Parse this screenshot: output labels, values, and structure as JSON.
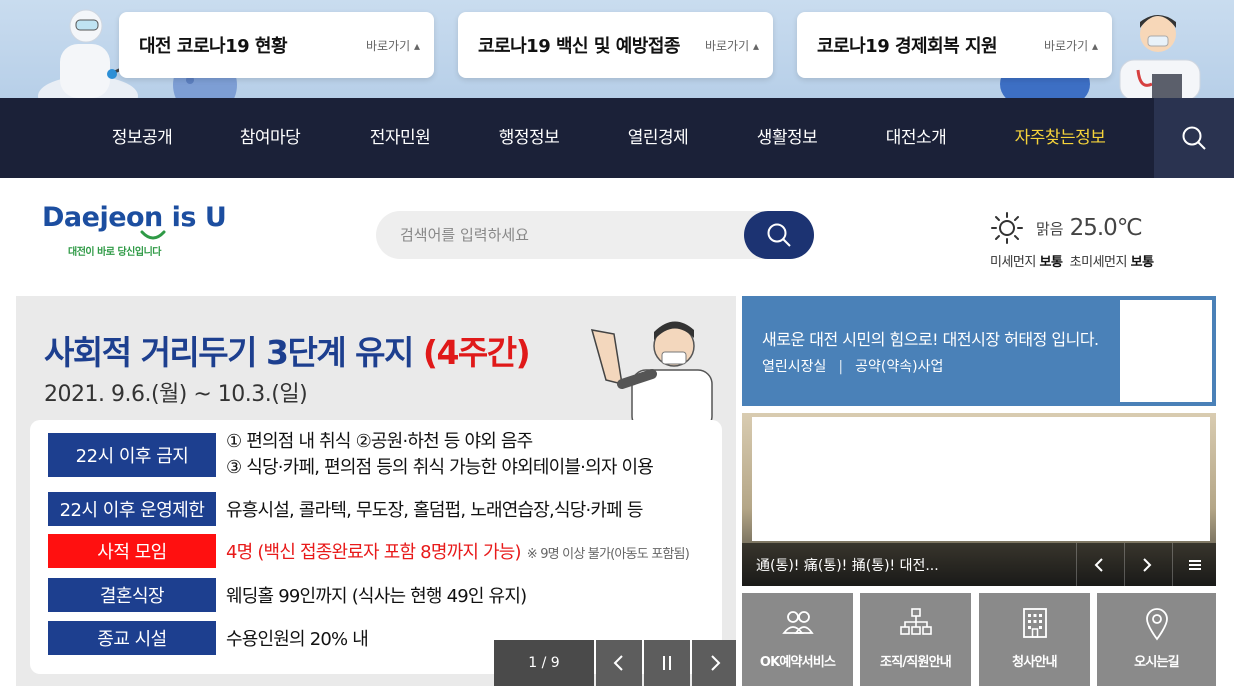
{
  "quick_links": [
    {
      "title": "대전 코로나19 현황",
      "link": "바로가기"
    },
    {
      "title": "코로나19 백신 및 예방접종",
      "link": "바로가기"
    },
    {
      "title": "코로나19 경제회복 지원",
      "link": "바로가기"
    }
  ],
  "gnb": {
    "items": [
      "정보공개",
      "참여마당",
      "전자민원",
      "행정정보",
      "열린경제",
      "생활정보",
      "대전소개",
      "자주찾는정보"
    ],
    "highlight_color": "#f5d33a"
  },
  "header": {
    "logo_text": "Daejeon is U",
    "logo_sub": "대전이 바로 당신입니다",
    "search_placeholder": "검색어를 입력하세요"
  },
  "weather": {
    "icon": "sun-icon",
    "condition": "맑음",
    "temperature": "25.0℃",
    "fine_dust_label": "미세먼지",
    "fine_dust_value": "보통",
    "ultrafine_dust_label": "초미세먼지",
    "ultrafine_dust_value": "보통"
  },
  "main_banner": {
    "title": "사회적 거리두기 3단계 유지",
    "title_highlight": "(4주간)",
    "date": "2021. 9.6.(월) ~ 10.3.(일)",
    "rules": [
      {
        "label": "22시 이후 금지",
        "text": "① 편의점 내 취식  ②공원·하천 등 야외 음주",
        "text2": "③ 식당·카페, 편의점 등의 취식 가능한 야외테이블·의자 이용"
      },
      {
        "label": "22시 이후 운영제한",
        "text": "유흥시설, 콜라텍, 무도장, 홀덤펍, 노래연습장,식당·카페 등"
      },
      {
        "label": "사적 모임",
        "text": "4명 (백신 접종완료자 포함 8명까지 가능)",
        "note": "※ 9명 이상 불가(아동도 포함됨)"
      },
      {
        "label": "결혼식장",
        "text": "웨딩홀 99인까지 (식사는 현행 49인 유지)"
      },
      {
        "label": "종교 시설",
        "text": "수용인원의 20% 내"
      }
    ],
    "pager": "1 / 9"
  },
  "mayor": {
    "title": "새로운 대전 시민의 힘으로! 대전시장 허태정 입니다.",
    "link1": "열린시장실",
    "link2": "공약(약속)사업"
  },
  "news": {
    "caption": "通(통)! 痛(통)! 捅(통)! 대전..."
  },
  "services": [
    {
      "label": "OK예약서비스",
      "icon": "people-icon"
    },
    {
      "label": "조직/직원안내",
      "icon": "org-chart-icon"
    },
    {
      "label": "청사안내",
      "icon": "building-icon"
    },
    {
      "label": "오시는길",
      "icon": "location-pin-icon"
    }
  ],
  "colors": {
    "gnb_bg": "#1b2138",
    "brand_blue": "#1d3f8f",
    "mayor_bg": "#4a81b8",
    "alert_red": "#ff1010"
  }
}
